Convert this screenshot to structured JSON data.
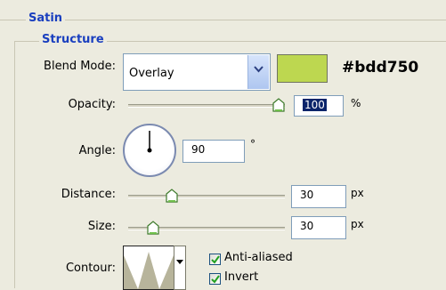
{
  "satin": {
    "title": "Satin"
  },
  "structure": {
    "title": "Structure",
    "blend_mode": {
      "label": "Blend Mode:",
      "value": "Overlay"
    },
    "color": {
      "hex": "#bdd750",
      "label": "#bdd750"
    },
    "opacity": {
      "label": "Opacity:",
      "value": "100",
      "unit": "%",
      "level_percent": 100
    },
    "angle": {
      "label": "Angle:",
      "value": "90",
      "unit": "°",
      "degrees": 90
    },
    "distance": {
      "label": "Distance:",
      "value": "30",
      "unit": "px",
      "level_fraction": 0.3
    },
    "size": {
      "label": "Size:",
      "value": "30",
      "unit": "px",
      "level_fraction": 0.17
    },
    "contour": {
      "label": "Contour:"
    },
    "anti_aliased": {
      "label": "Anti-aliased",
      "checked": true
    },
    "invert": {
      "label": "Invert",
      "checked": true
    }
  },
  "icons": [
    "dropdown-arrow-icon",
    "slider-thumb-icon",
    "checkmark-icon",
    "contour-curve-icon"
  ]
}
